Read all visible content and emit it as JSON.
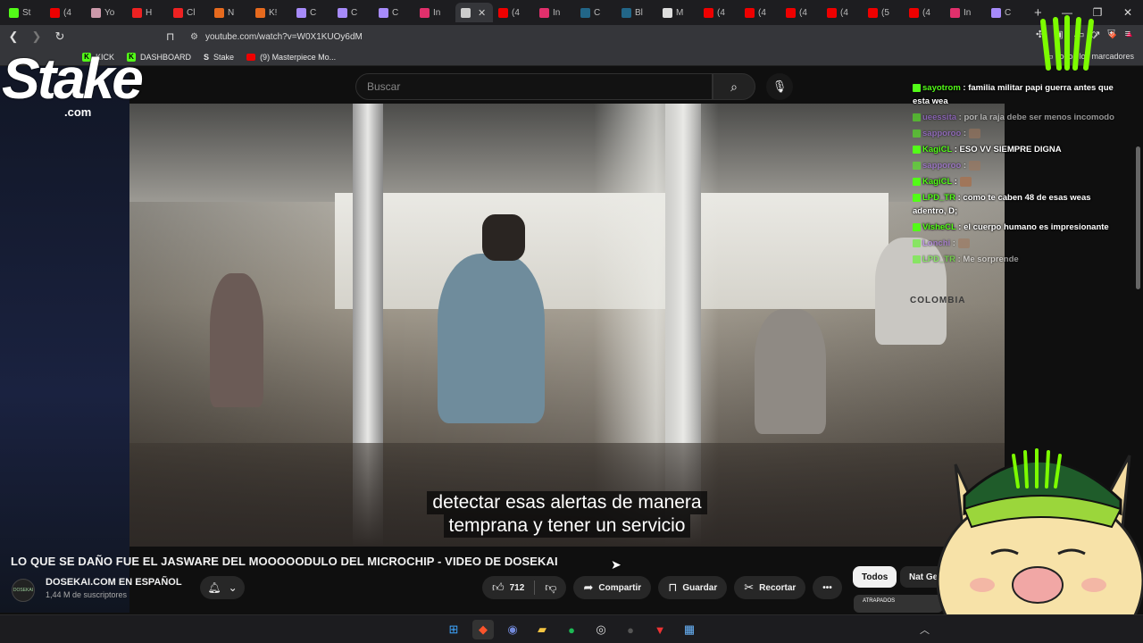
{
  "browser": {
    "tabs": [
      {
        "label": "St",
        "color": "#53fc18"
      },
      {
        "label": "(4",
        "color": "#e00"
      },
      {
        "label": "Yo",
        "color": "#c9a"
      },
      {
        "label": "H",
        "color": "#e22"
      },
      {
        "label": "Cl",
        "color": "#e22"
      },
      {
        "label": "N",
        "color": "#e66a1e"
      },
      {
        "label": "K!",
        "color": "#e66a1e"
      },
      {
        "label": "C",
        "color": "#a78bfa"
      },
      {
        "label": "C",
        "color": "#a78bfa"
      },
      {
        "label": "C",
        "color": "#a78bfa"
      },
      {
        "label": "In",
        "color": "#e1306c"
      },
      {
        "label": "",
        "color": "#ccc",
        "active": true
      },
      {
        "label": "(4",
        "color": "#e00"
      },
      {
        "label": "In",
        "color": "#e1306c"
      },
      {
        "label": "C",
        "color": "#268"
      },
      {
        "label": "Bl",
        "color": "#268"
      },
      {
        "label": "M",
        "color": "#ddd"
      },
      {
        "label": "(4",
        "color": "#e00"
      },
      {
        "label": "(4",
        "color": "#e00"
      },
      {
        "label": "(4",
        "color": "#e00"
      },
      {
        "label": "(4",
        "color": "#e00"
      },
      {
        "label": "(5",
        "color": "#e00"
      },
      {
        "label": "(4",
        "color": "#e00"
      },
      {
        "label": "In",
        "color": "#e1306c"
      },
      {
        "label": "C",
        "color": "#a78bfa"
      }
    ],
    "url": "youtube.com/watch?v=W0X1KUOy6dM",
    "bookmarks": [
      {
        "label": "KICK",
        "icon": "kick"
      },
      {
        "label": "DASHBOARD",
        "icon": "kick"
      },
      {
        "label": "Stake",
        "icon": "stake"
      },
      {
        "label": "(9) Masterpiece Mo...",
        "icon": "youtube"
      }
    ],
    "all_bookmarks": "Todos los marcadores"
  },
  "youtube": {
    "search_placeholder": "Buscar",
    "subtitles": [
      "detectar esas alertas de manera",
      "temprana y tener un servicio"
    ],
    "colombia_sign": "COLOMBIA",
    "video_title": "LO QUE SE DAÑO FUE EL JASWARE DEL MOOOOODULO DEL MICROCHIP - VIDEO DE DOSEKAI",
    "channel_name": "DOSEKAI.COM EN ESPAÑOL",
    "subscribers": "1,44 M de suscriptores",
    "likes": "712",
    "share": "Compartir",
    "save": "Guardar",
    "clip": "Recortar",
    "more": "•••",
    "chips": [
      "Todos",
      "Nat Geo"
    ],
    "thumb_text": "ATRAPADOS"
  },
  "overlay": {
    "stake_logo": "Stake",
    "stake_com": ".com",
    "chat": [
      {
        "user": "sayotrom",
        "color": "#53fc18",
        "text": "familia militar papi guerra antes que esta wea"
      },
      {
        "user": "ueessita",
        "color": "#b06dfc",
        "text": "por la raja debe ser menos incomodo",
        "fade": true
      },
      {
        "user": "sapporoo",
        "color": "#b06dfc",
        "text": "",
        "emote": true,
        "fade": true
      },
      {
        "user": "KagiCL",
        "color": "#53fc18",
        "text": "ESO VV SIEMPRE DIGNA"
      },
      {
        "user": "sapporoo",
        "color": "#b06dfc",
        "text": "",
        "emote": true,
        "fade": true
      },
      {
        "user": "KagiCL",
        "color": "#53fc18",
        "text": "",
        "emote": true
      },
      {
        "user": "LPD_TR",
        "color": "#53fc18",
        "text": "como te caben 48 de esas weas adentro, D;"
      },
      {
        "user": "VisheCL",
        "color": "#53fc18",
        "text": "el cuerpo humano es impresionante"
      },
      {
        "user": "Lonchi",
        "color": "#b06dfc",
        "text": "",
        "emote": true,
        "fade": true
      },
      {
        "user": "LPD_TR",
        "color": "#53fc18",
        "text": "Me sorprende",
        "fade": true
      }
    ]
  }
}
